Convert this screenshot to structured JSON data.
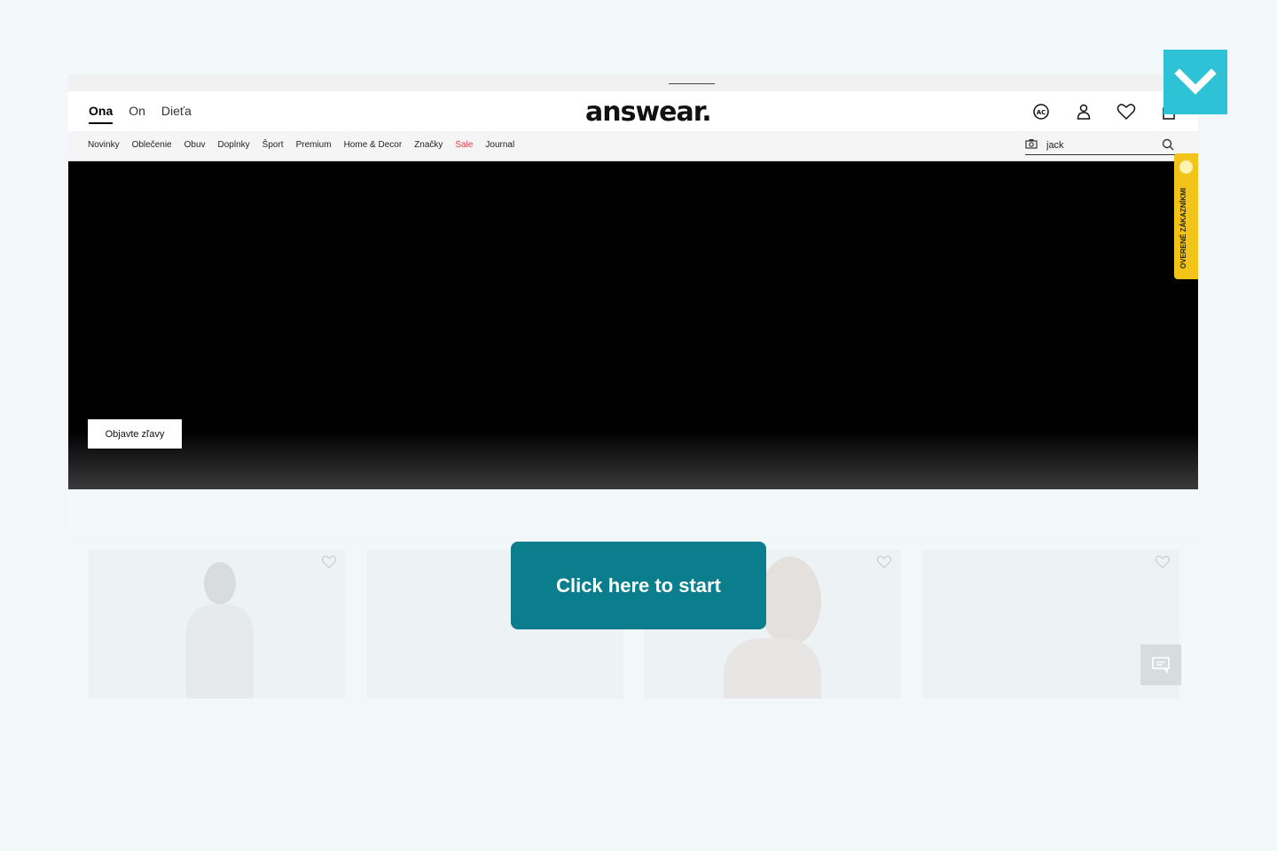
{
  "header": {
    "gender_tabs": [
      "Ona",
      "On",
      "Dieťa"
    ],
    "active_tab": "Ona",
    "logo": "answear.",
    "icons": [
      "ac-icon",
      "user-icon",
      "heart-icon",
      "bag-icon"
    ]
  },
  "nav": {
    "items": [
      "Novinky",
      "Oblečenie",
      "Obuv",
      "Doplnky",
      "Šport",
      "Premium",
      "Home & Decor",
      "Značky",
      "Sale",
      "Journal"
    ],
    "sale_color": "#e03a4e"
  },
  "search": {
    "value": "jack"
  },
  "hero": {
    "button_label": "Objavte zľavy"
  },
  "badge": {
    "label": "OVERENÉ ZÁKAZNÍKMI"
  },
  "cta": {
    "label": "Click here to start",
    "color": "#0a7e8c"
  },
  "corner": {
    "color": "#2ec2d6",
    "icon": "chevron-down-icon"
  },
  "chat": {
    "icon": "chat-icon"
  }
}
